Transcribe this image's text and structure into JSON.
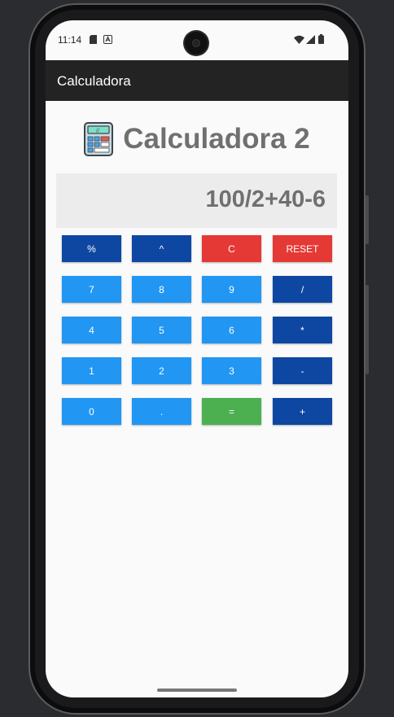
{
  "status_bar": {
    "time": "11:14"
  },
  "app_bar": {
    "title": "Calculadora"
  },
  "header": {
    "title": "Calculadora 2",
    "icon": "calculator-icon"
  },
  "display": {
    "expression": "100/2+40-6"
  },
  "keypad": {
    "rows": [
      [
        {
          "label": "%",
          "kind": "operator"
        },
        {
          "label": "^",
          "kind": "operator"
        },
        {
          "label": "C",
          "kind": "clear"
        },
        {
          "label": "RESET",
          "kind": "clear"
        }
      ],
      [
        {
          "label": "7",
          "kind": "digit"
        },
        {
          "label": "8",
          "kind": "digit"
        },
        {
          "label": "9",
          "kind": "digit"
        },
        {
          "label": "/",
          "kind": "operator"
        }
      ],
      [
        {
          "label": "4",
          "kind": "digit"
        },
        {
          "label": "5",
          "kind": "digit"
        },
        {
          "label": "6",
          "kind": "digit"
        },
        {
          "label": "*",
          "kind": "operator"
        }
      ],
      [
        {
          "label": "1",
          "kind": "digit"
        },
        {
          "label": "2",
          "kind": "digit"
        },
        {
          "label": "3",
          "kind": "digit"
        },
        {
          "label": "-",
          "kind": "operator"
        }
      ],
      [
        {
          "label": "0",
          "kind": "digit"
        },
        {
          "label": ".",
          "kind": "digit"
        },
        {
          "label": "=",
          "kind": "equals"
        },
        {
          "label": "+",
          "kind": "operator"
        }
      ]
    ]
  },
  "colors": {
    "digit": "#2196f3",
    "operator": "#0d47a1",
    "clear": "#e53935",
    "equals": "#4caf50",
    "app_bar": "#232323",
    "title_text": "#707070"
  }
}
